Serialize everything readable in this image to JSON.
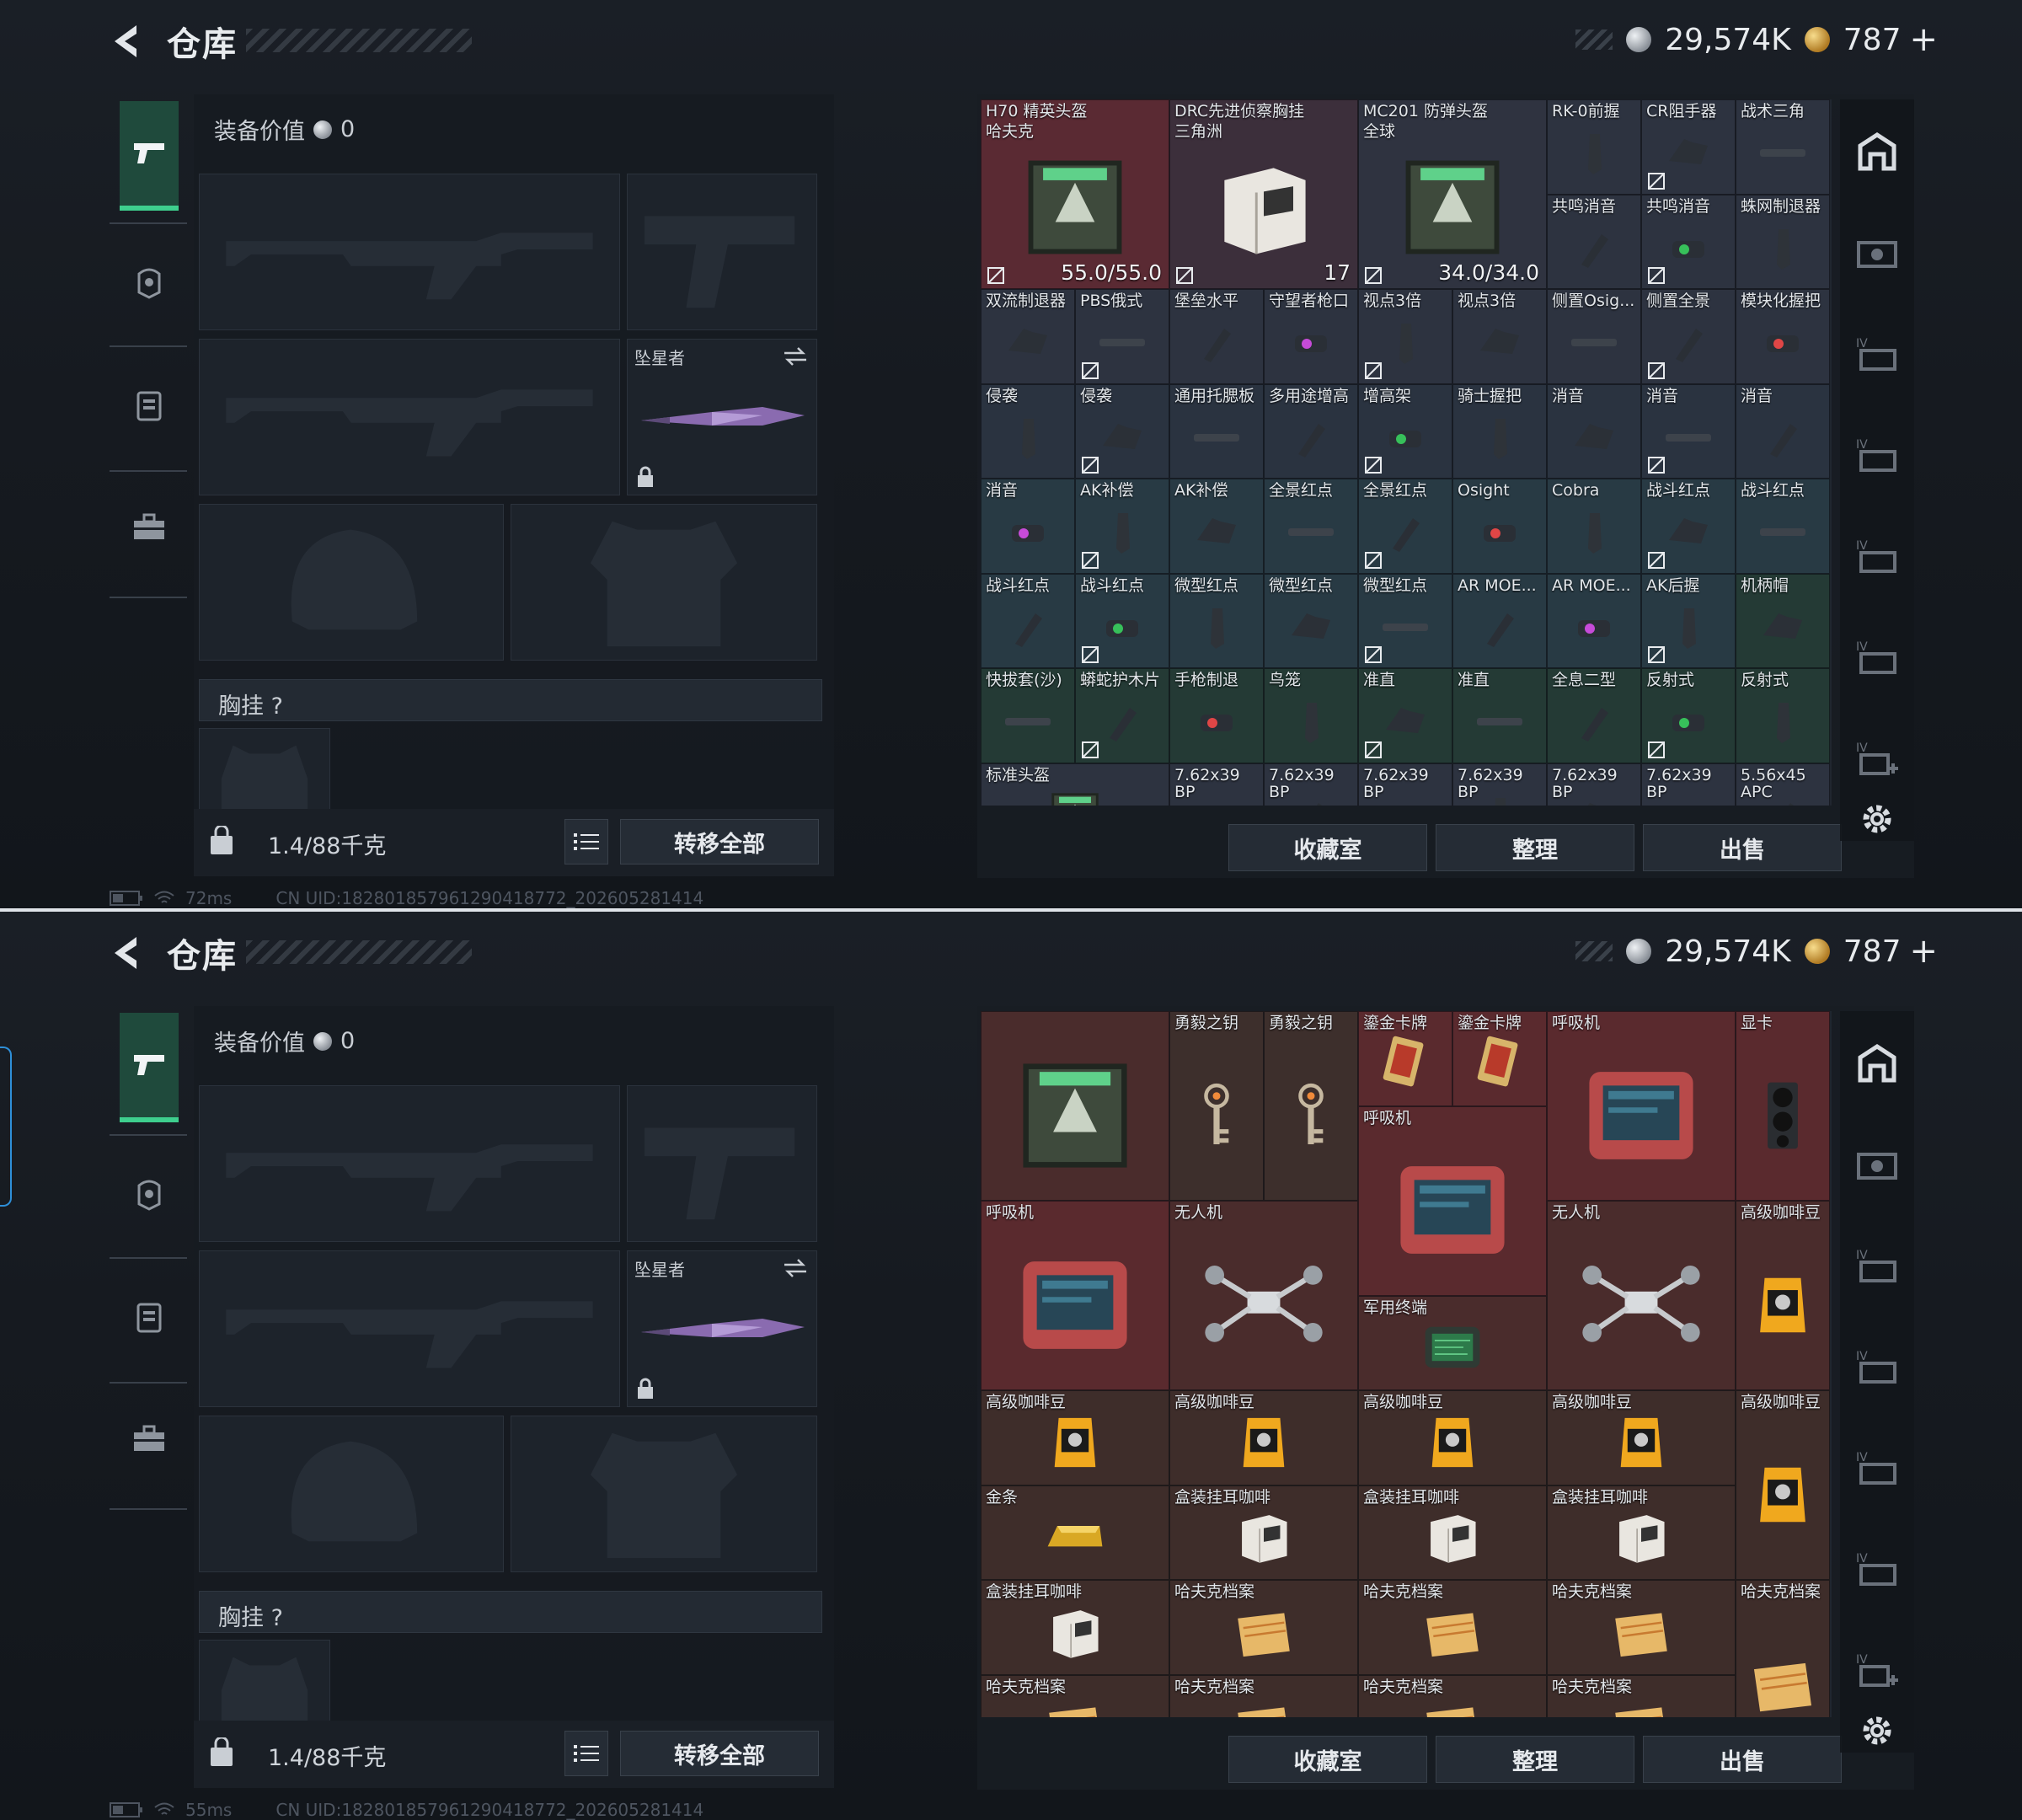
{
  "panels": [
    {
      "title": "仓库",
      "currency": {
        "silver": "29,574K",
        "gold": "787"
      },
      "equip_value_label": "装备价值",
      "equip_value": "0",
      "melee_name": "坠星者",
      "chest_label": "胸挂",
      "chest_help": "?",
      "weight": "1.4/88千克",
      "transfer_all": "转移全部",
      "ping": "72ms",
      "uid": "CN UID:182801857961290418772_202605281414",
      "buttons": {
        "collection": "收藏室",
        "sort": "整理",
        "sell": "出售"
      },
      "items": [
        {
          "name": "H70 精英头盔",
          "sub": "哈夫克",
          "value": "55.0/55.0",
          "bg": "#5a2a33"
        },
        {
          "name": "DRC先进侦察胸挂",
          "sub": "三角洲",
          "value": "17",
          "bg": "#3c2f3b"
        },
        {
          "name": "MC201 防弹头盔",
          "sub": "全球",
          "value": "34.0/34.0",
          "bg": "#2f3340"
        },
        {
          "name": "RK-0前握",
          "bg": "#2d3340"
        },
        {
          "name": "CR阻手器",
          "bg": "#2d3340"
        },
        {
          "name": "战术三角",
          "bg": "#2d3340"
        },
        {
          "name": "共鸣消音",
          "bg": "#2d3340"
        },
        {
          "name": "共鸣消音",
          "bg": "#2d3340"
        },
        {
          "name": "蛛网制退器",
          "bg": "#2d3340"
        },
        {
          "name": "双流制退器",
          "bg": "#2d3340"
        },
        {
          "name": "PBS俄式",
          "bg": "#2d3340"
        },
        {
          "name": "堡垒水平",
          "bg": "#2d3340"
        },
        {
          "name": "守望者枪口",
          "bg": "#2d3340"
        },
        {
          "name": "视点3倍",
          "bg": "#2d3340"
        },
        {
          "name": "视点3倍",
          "bg": "#2d3340"
        },
        {
          "name": "侧置Osig...",
          "bg": "#2d3340"
        },
        {
          "name": "侧置全景",
          "bg": "#2d3340"
        },
        {
          "name": "模块化握把",
          "bg": "#2d3340"
        },
        {
          "name": "侵袭",
          "bg": "#2a3340"
        },
        {
          "name": "侵袭",
          "bg": "#2a3340"
        },
        {
          "name": "通用托腮板",
          "bg": "#2a3340"
        },
        {
          "name": "多用途增高",
          "bg": "#2a3340"
        },
        {
          "name": "增高架",
          "bg": "#2a3340"
        },
        {
          "name": "骑士握把",
          "bg": "#2a3340"
        },
        {
          "name": "消音",
          "bg": "#2a3340"
        },
        {
          "name": "消音",
          "bg": "#2a3340"
        },
        {
          "name": "消音",
          "bg": "#2a3340"
        },
        {
          "name": "消音",
          "bg": "#283a44"
        },
        {
          "name": "AK补偿",
          "bg": "#283a44"
        },
        {
          "name": "AK补偿",
          "bg": "#283a44"
        },
        {
          "name": "全景红点",
          "bg": "#283a44"
        },
        {
          "name": "全景红点",
          "bg": "#283a44"
        },
        {
          "name": "Osight",
          "bg": "#283a44"
        },
        {
          "name": "Cobra",
          "bg": "#283a44"
        },
        {
          "name": "战斗红点",
          "bg": "#283a44"
        },
        {
          "name": "战斗红点",
          "bg": "#283a44"
        },
        {
          "name": "战斗红点",
          "bg": "#283a44"
        },
        {
          "name": "战斗红点",
          "bg": "#283a44"
        },
        {
          "name": "微型红点",
          "bg": "#283a44"
        },
        {
          "name": "微型红点",
          "bg": "#283a44"
        },
        {
          "name": "微型红点",
          "bg": "#283a44"
        },
        {
          "name": "AR MOE...",
          "bg": "#283a44"
        },
        {
          "name": "AR MOE...",
          "bg": "#283a44"
        },
        {
          "name": "AK后握",
          "bg": "#283a44"
        },
        {
          "name": "机柄帽",
          "bg": "#243a35"
        },
        {
          "name": "快拔套(沙)",
          "bg": "#243a35"
        },
        {
          "name": "蟒蛇护木片",
          "bg": "#243a35"
        },
        {
          "name": "手枪制退",
          "bg": "#243a35"
        },
        {
          "name": "鸟笼",
          "bg": "#243a35"
        },
        {
          "name": "准直",
          "bg": "#243a35"
        },
        {
          "name": "准直",
          "bg": "#243a35"
        },
        {
          "name": "全息二型",
          "bg": "#243a35"
        },
        {
          "name": "反射式",
          "bg": "#243a35"
        },
        {
          "name": "反射式",
          "bg": "#243a35"
        },
        {
          "name": "标准头盔",
          "bg": "#2d3340"
        },
        {
          "name": "7.62x39",
          "sub": "BP",
          "bg": "#2d3340"
        },
        {
          "name": "7.62x39",
          "sub": "BP",
          "bg": "#2d3340"
        },
        {
          "name": "7.62x39",
          "sub": "BP",
          "bg": "#2d3340"
        },
        {
          "name": "7.62x39",
          "sub": "BP",
          "bg": "#2d3340"
        },
        {
          "name": "7.62x39",
          "sub": "BP",
          "bg": "#2d3340"
        },
        {
          "name": "7.62x39",
          "sub": "BP",
          "bg": "#2d3340"
        },
        {
          "name": "5.56x45",
          "sub": "APC",
          "bg": "#2d3340"
        }
      ]
    },
    {
      "title": "仓库",
      "currency": {
        "silver": "29,574K",
        "gold": "787"
      },
      "equip_value_label": "装备价值",
      "equip_value": "0",
      "melee_name": "坠星者",
      "chest_label": "胸挂",
      "chest_help": "?",
      "weight": "1.4/88千克",
      "transfer_all": "转移全部",
      "ping": "55ms",
      "uid": "CN UID:182801857961290418772_202605281414",
      "buttons": {
        "collection": "收藏室",
        "sort": "整理",
        "sell": "出售"
      },
      "items": [
        {
          "name": "",
          "icon": "crate",
          "bg": "#4a2c2c"
        },
        {
          "name": "勇毅之钥",
          "icon": "key",
          "bg": "#3d2f2c"
        },
        {
          "name": "勇毅之钥",
          "icon": "key",
          "bg": "#3d2f2c"
        },
        {
          "name": "鎏金卡牌",
          "icon": "card",
          "bg": "#5a2a2e"
        },
        {
          "name": "鎏金卡牌",
          "icon": "card",
          "bg": "#5a2a2e"
        },
        {
          "name": "呼吸机",
          "icon": "device",
          "bg": "#5a2a2e"
        },
        {
          "name": "显卡",
          "icon": "gpu",
          "bg": "#5a2a2e"
        },
        {
          "name": "呼吸机",
          "icon": "device",
          "bg": "#5a2a2e"
        },
        {
          "name": "呼吸机",
          "icon": "device",
          "bg": "#5a2a2e"
        },
        {
          "name": "无人机",
          "icon": "drone",
          "bg": "#4a2c2c"
        },
        {
          "name": "军用终端",
          "icon": "terminal",
          "bg": "#4a2c2c"
        },
        {
          "name": "无人机",
          "icon": "drone",
          "bg": "#4a2c2c"
        },
        {
          "name": "高级咖啡豆",
          "icon": "coffee",
          "bg": "#4a2c2c"
        },
        {
          "name": "高级咖啡豆",
          "icon": "coffee",
          "bg": "#3e2d2a"
        },
        {
          "name": "高级咖啡豆",
          "icon": "coffee",
          "bg": "#3e2d2a"
        },
        {
          "name": "高级咖啡豆",
          "icon": "coffee",
          "bg": "#3e2d2a"
        },
        {
          "name": "高级咖啡豆",
          "icon": "coffee",
          "bg": "#3e2d2a"
        },
        {
          "name": "高级咖啡豆",
          "icon": "coffee",
          "bg": "#3e2d2a"
        },
        {
          "name": "金条",
          "icon": "gold",
          "bg": "#3e2d2a"
        },
        {
          "name": "盒装挂耳咖啡",
          "icon": "box",
          "bg": "#3e2d2a"
        },
        {
          "name": "盒装挂耳咖啡",
          "icon": "box",
          "bg": "#3e2d2a"
        },
        {
          "name": "盒装挂耳咖啡",
          "icon": "box",
          "bg": "#3e2d2a"
        },
        {
          "name": "盒装挂耳咖啡",
          "icon": "box",
          "bg": "#3e2d2a"
        },
        {
          "name": "哈夫克档案",
          "icon": "folder",
          "bg": "#3e2d2a"
        },
        {
          "name": "哈夫克档案",
          "icon": "folder",
          "bg": "#3e2d2a"
        },
        {
          "name": "哈夫克档案",
          "icon": "folder",
          "bg": "#3e2d2a"
        },
        {
          "name": "哈夫克档案",
          "icon": "folder",
          "bg": "#3e2d2a"
        },
        {
          "name": "哈夫克档案",
          "icon": "folder",
          "bg": "#3e2d2a"
        },
        {
          "name": "哈夫克档案",
          "icon": "folder",
          "bg": "#3e2d2a"
        },
        {
          "name": "哈夫克档案",
          "icon": "folder",
          "bg": "#3e2d2a"
        },
        {
          "name": "哈夫克档案",
          "icon": "folder",
          "bg": "#3e2d2a"
        }
      ]
    }
  ],
  "colors": {
    "accent": "#3ecf8e",
    "red_tier": "#5a2a33",
    "blue_tier": "#283a44",
    "green_tier": "#243a35"
  }
}
